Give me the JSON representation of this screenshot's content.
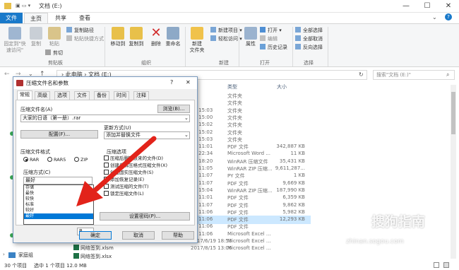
{
  "window": {
    "title": "文档 (E:)",
    "minimize": "—",
    "maximize": "☐",
    "close": "✕",
    "help": "?"
  },
  "tabs": {
    "file": "文件",
    "home": "主页",
    "share": "共享",
    "view": "查看"
  },
  "ribbon": {
    "pin_label": "固定到\"快速访问\"",
    "copy_label": "复制",
    "paste_label": "粘贴",
    "copy_path": "复制路径",
    "paste_shortcut": "粘贴快捷方式",
    "cut": "剪切",
    "clipboard_group": "剪贴板",
    "move_to": "移动到",
    "copy_to": "复制到",
    "delete": "删除",
    "rename": "重命名",
    "organize_group": "组织",
    "new_folder": "新建\n文件夹",
    "new_item": "新建项目",
    "easy_access": "轻松访问",
    "new_group": "新建",
    "properties": "属性",
    "open": "打开",
    "edit": "编辑",
    "history": "历史记录",
    "open_group": "打开",
    "select_all": "全部选择",
    "select_none": "全部取消",
    "invert_selection": "反向选择",
    "select_group": "选择"
  },
  "address": {
    "path": "› 此电脑 › 文档 (E:)",
    "search_placeholder": "搜索\"文档 (E:)\""
  },
  "list": {
    "headers": {
      "type": "类型",
      "size": "大小"
    },
    "rows": [
      {
        "date": "",
        "type": "文件夹",
        "size": ""
      },
      {
        "date": "",
        "type": "文件夹",
        "size": ""
      },
      {
        "date": "29 15:03",
        "type": "文件夹",
        "size": ""
      },
      {
        "date": "29 15:00",
        "type": "文件夹",
        "size": ""
      },
      {
        "date": "29 15:02",
        "type": "文件夹",
        "size": ""
      },
      {
        "date": "29 15:02",
        "type": "文件夹",
        "size": ""
      },
      {
        "date": "29 15:03",
        "type": "文件夹",
        "size": ""
      },
      {
        "date": "20 11:01",
        "type": "PDF 文件",
        "size": "342,887 KB"
      },
      {
        "date": "22 22:34",
        "type": "Microsoft Word ...",
        "size": "11 KB"
      },
      {
        "date": "31 18:20",
        "type": "WinRAR 压缩文件",
        "size": "35,431 KB"
      },
      {
        "date": "20 11:05",
        "type": "WinRAR ZIP 压缩...",
        "size": "9,611,287..."
      },
      {
        "date": "20 11:07",
        "type": "PY 文件",
        "size": "1 KB"
      },
      {
        "date": "20 11:07",
        "type": "PDF 文件",
        "size": "9,669 KB"
      },
      {
        "date": "29 15:04",
        "type": "WinRAR ZIP 压缩...",
        "size": "187,990 KB"
      },
      {
        "date": "20 11:01",
        "type": "PDF 文件",
        "size": "6,359 KB"
      },
      {
        "date": "20 11:07",
        "type": "PDF 文件",
        "size": "9,862 KB"
      },
      {
        "date": "20 11:06",
        "type": "PDF 文件",
        "size": "5,982 KB"
      },
      {
        "date": "20 11:06",
        "type": "PDF 文件",
        "size": "12,293 KB"
      },
      {
        "date": "20 11:06",
        "type": "PDF 文件",
        "size": ""
      },
      {
        "date": "20 11:06",
        "type": "Microsoft Excel ...",
        "size": ""
      },
      {
        "date": "2017/6/19 18:53",
        "type": "Microsoft Excel ...",
        "size": ""
      },
      {
        "date": "2017/8/15 13:06",
        "type": "Microsoft Excel ...",
        "size": ""
      }
    ],
    "tail_names": [
      "网络签到.xlsm",
      "网络签到.xlsx"
    ]
  },
  "nav": {
    "homegroup": "家庭组"
  },
  "status": {
    "count": "30 个项目",
    "selected": "选中 1 个项目  12.0 MB"
  },
  "dialog": {
    "title": "压缩文件名和参数",
    "tabs": [
      "常规",
      "高级",
      "选项",
      "文件",
      "备份",
      "时间",
      "注释"
    ],
    "archive_name_label": "压缩文件名(A)",
    "browse": "浏览(B)...",
    "archive_name": "大家的日语（第一册）.rar",
    "profiles": "配置(F)...",
    "update_mode_label": "更新方式(U)",
    "update_mode": "添加并替换文件",
    "format_label": "压缩文件格式",
    "formats": [
      "RAR",
      "RAR5",
      "ZIP"
    ],
    "options_label": "压缩选项",
    "options": [
      "压缩后删除原来的文件(D)",
      "创建自解压格式压缩文件(X)",
      "创建固实压缩文件(S)",
      "添加恢复记录(E)",
      "测试压缩的文件(T)",
      "锁定压缩文件(L)"
    ],
    "method_label": "压缩方式(C)",
    "method_value": "最好",
    "method_options": [
      "存储",
      "最快",
      "较快",
      "标准",
      "较好",
      "最好"
    ],
    "split_value": "B",
    "set_password": "设置密码(P)...",
    "ok": "确定",
    "cancel": "取消",
    "help": "帮助"
  },
  "watermark": {
    "brand": "搜狗指南",
    "url": "zhinan.sogou.com"
  },
  "colors": {
    "accent": "#1979ca",
    "arrow": "#e2231a",
    "selection": "#cce8ff"
  }
}
